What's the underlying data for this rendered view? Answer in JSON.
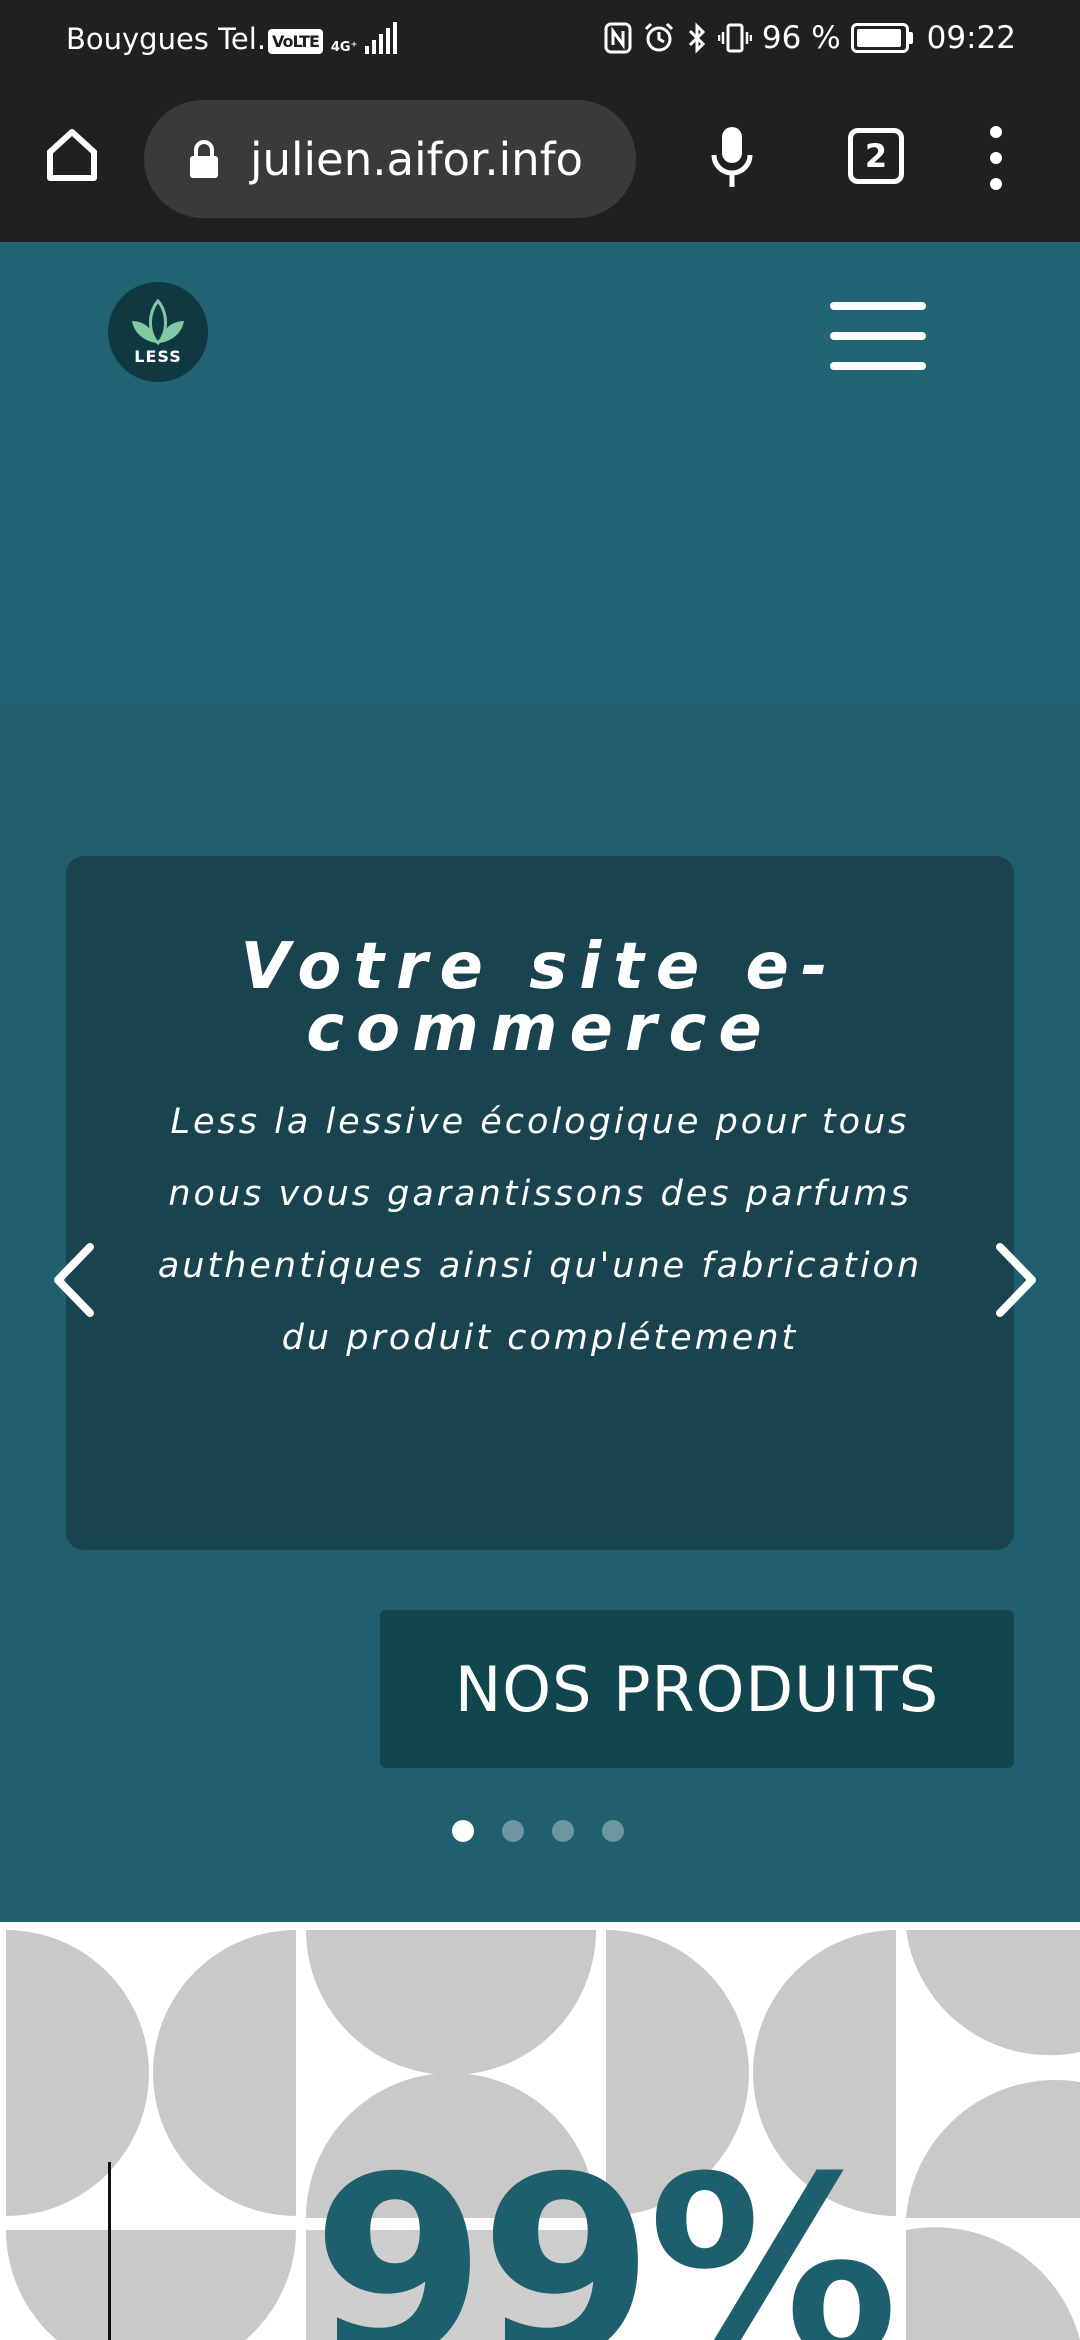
{
  "status_bar": {
    "carrier": "Bouygues Tel...",
    "volte": "VoLTE",
    "network": "4G⁺",
    "battery": "96 %",
    "battery_level": 0.96,
    "time": "09:22"
  },
  "browser": {
    "url": "julien.aifor.info",
    "tab_count": "2"
  },
  "site": {
    "logo_text": "LESS",
    "hero": {
      "title": "Votre site e-commerce",
      "description": "Less la lessive écologique pour tous nous vous garantissons des parfums authentiques ainsi qu'une fabrication du produit complétement",
      "cta": "NOS PRODUITS",
      "slide_count": 4,
      "active_slide": 1
    },
    "stat_value": "99%"
  },
  "colors": {
    "status_bg": "#202020",
    "header_bg": "#216372",
    "hero_bg": "#1f5f6e",
    "card_bg": "#1a4350",
    "cta_bg": "#12464f",
    "stat_color": "#1d5f6c",
    "pattern_gray": "#c9c9c9"
  }
}
